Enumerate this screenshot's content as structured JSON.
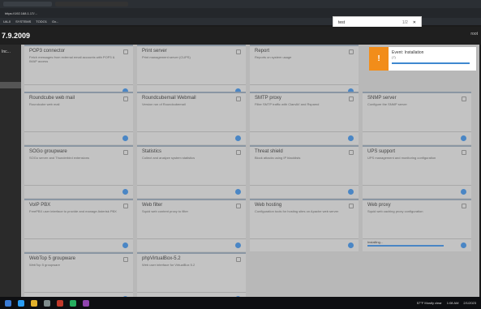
{
  "browser": {
    "tab_title": "N...",
    "address": "https://192.168.1.17/...",
    "bookmarks": [
      "UA-0",
      "SYSTEMS",
      "TODO1",
      "Gx..."
    ],
    "find": {
      "query": "test",
      "count": "1/2"
    }
  },
  "app": {
    "version": "7.9.2009",
    "user": "root",
    "sidebar_label": "Inc..."
  },
  "event_popup": {
    "title": "Event: Installation",
    "detail": "(7)",
    "status": "in-progress"
  },
  "cards": [
    {
      "name": "POP3 connector",
      "desc": "Fetch messages from external email accounts with POP3 & IMAP access",
      "info": true
    },
    {
      "name": "Print server",
      "desc": "Print management server (CUPS)",
      "info": true
    },
    {
      "name": "Report",
      "desc": "Reports on system usage",
      "info": true
    },
    {
      "name": "Roundcube web mail",
      "desc": "Roundcube web mail",
      "info": true
    },
    {
      "name": "Roundcubemail Webmail",
      "desc": "Version run of Roundcubemail",
      "info": true
    },
    {
      "name": "SMTP proxy",
      "desc": "Filter SMTP traffic with ClamAV and Rspamd",
      "info": true
    },
    {
      "name": "SNMP server",
      "desc": "Configure the SNMP server",
      "info": true
    },
    {
      "name": "SOGo groupware",
      "desc": "SOGo server and Thunderbird extensions",
      "info": true
    },
    {
      "name": "Statistics",
      "desc": "Collect and analyze system statistics",
      "info": true
    },
    {
      "name": "Threat shield",
      "desc": "Block attacks using IP blacklists",
      "info": true
    },
    {
      "name": "UPS support",
      "desc": "UPS management and monitoring configuration",
      "info": true
    },
    {
      "name": "VoIP PBX",
      "desc": "FreePBX user interface to provide and manage Asterisk PBX",
      "info": true
    },
    {
      "name": "Web filter",
      "desc": "Squid web content proxy to filter",
      "info": true
    },
    {
      "name": "Web hosting",
      "desc": "Configuration tools for hosting sites on Apache web server",
      "info": true
    },
    {
      "name": "Web proxy",
      "desc": "Squid web caching proxy configuration",
      "info": true,
      "progress_label": "Installing...",
      "progress": 0.85
    },
    {
      "name": "WebTop 5 groupware",
      "desc": "WebTop 5 groupware",
      "info": true
    },
    {
      "name": "phpVirtualBox-5.2",
      "desc": "Web user interface for VirtualBox 5.2",
      "info": true
    }
  ],
  "taskbar": {
    "weather": "57°F Mostly clear",
    "time": "1:08 AM",
    "date": "2/1/2023"
  }
}
